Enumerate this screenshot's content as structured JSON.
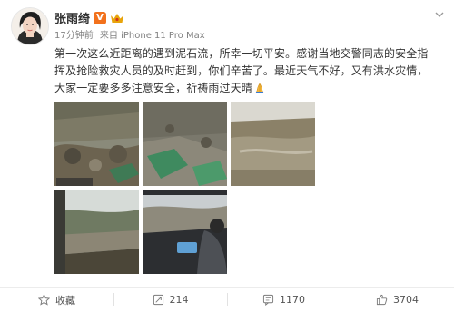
{
  "post": {
    "username": "张雨绮",
    "verified_badge": "V",
    "time": "17分钟前",
    "source": "来自 iPhone 11 Pro Max",
    "text": "第一次这么近距离的遇到泥石流，所幸一切平安。感谢当地交警同志的安全指挥及抢险救灾人员的及时赶到，你们辛苦了。最近天气不好，又有洪水灾情，大家一定要多多注意安全，祈祷雨过天晴"
  },
  "actions": {
    "favorite": "收藏",
    "repost": "214",
    "comment": "1170",
    "like": "3704"
  },
  "colors": {
    "verified": "#f2711c",
    "accent_crown": "#e8a40b",
    "text": "#333333",
    "meta": "#808080"
  }
}
